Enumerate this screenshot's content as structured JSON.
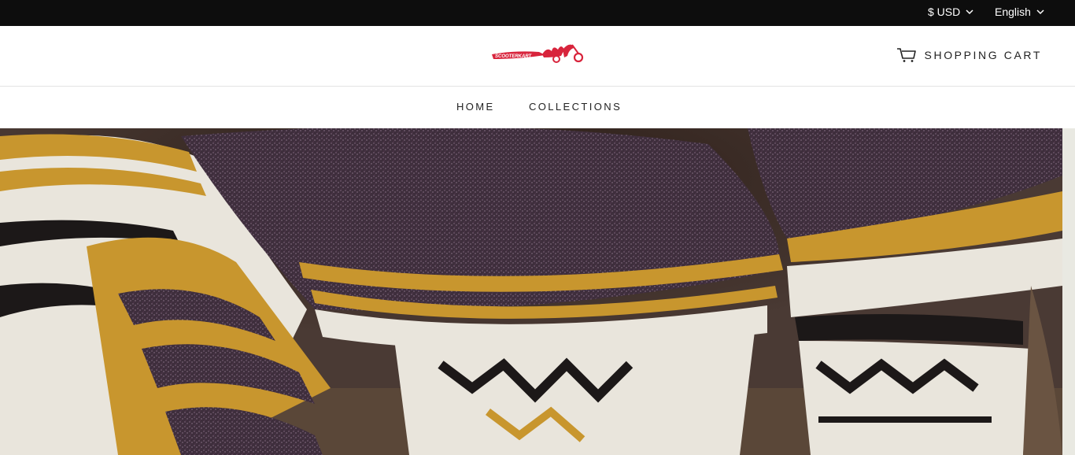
{
  "topbar": {
    "currency": "$ USD",
    "language": "English"
  },
  "header": {
    "logo_text": "SCOOTERKART",
    "cart_label": "SHOPPING CART"
  },
  "nav": {
    "items": [
      {
        "label": "HOME"
      },
      {
        "label": "COLLECTIONS"
      }
    ]
  },
  "hero": {
    "image": "woven-blanket-photo",
    "colors": {
      "mustard": "#c8962e",
      "plum": "#3e2e3c",
      "cream": "#e9e5dc",
      "black": "#1c1818"
    }
  },
  "colors": {
    "topbar_bg": "#0d0d0d",
    "brand_red": "#d8243c"
  },
  "icons": {
    "dropdown": "chevron-down-icon",
    "cart": "cart-icon"
  }
}
